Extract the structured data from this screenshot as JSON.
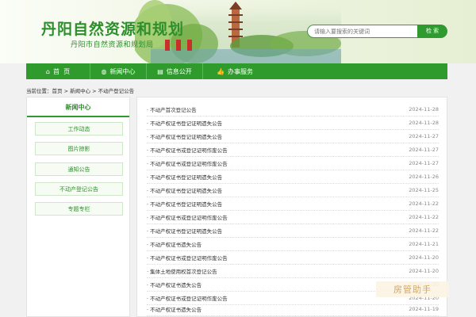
{
  "header": {
    "site_title": "丹阳自然资源和规划",
    "site_subtitle": "丹阳市自然资源和规划局",
    "search_placeholder": "请输入要搜索的关键词",
    "search_button": "检 索"
  },
  "nav": {
    "items": [
      {
        "label": "首  页",
        "icon": "home-icon"
      },
      {
        "label": "新闻中心",
        "icon": "globe-icon"
      },
      {
        "label": "信息公开",
        "icon": "document-icon"
      },
      {
        "label": "办事服务",
        "icon": "thumbs-up-icon"
      }
    ]
  },
  "breadcrumb": {
    "text": "当前位置：首页 > 新闻中心 > 不动产登记公告"
  },
  "sidebar": {
    "title": "新闻中心",
    "items": [
      "工作动态",
      "图片掠影",
      "通知公告",
      "不动产登记公告",
      "专题专栏"
    ]
  },
  "news": {
    "items": [
      {
        "title": "· 不动产首次登记公告",
        "date": "2024-11-28"
      },
      {
        "title": "· 不动产权证书登记证明遗失公告",
        "date": "2024-11-28"
      },
      {
        "title": "· 不动产权证书登记证明遗失公告",
        "date": "2024-11-27"
      },
      {
        "title": "· 不动产权证书或登记证明作废公告",
        "date": "2024-11-27"
      },
      {
        "title": "· 不动产权证书或登记证明作废公告",
        "date": "2024-11-27"
      },
      {
        "title": "· 不动产权证书登记证明遗失公告",
        "date": "2024-11-26"
      },
      {
        "title": "· 不动产权证书登记证明遗失公告",
        "date": "2024-11-25"
      },
      {
        "title": "· 不动产权证书登记证明遗失公告",
        "date": "2024-11-22"
      },
      {
        "title": "· 不动产权证书或登记证明作废公告",
        "date": "2024-11-22"
      },
      {
        "title": "· 不动产权证书登记证明遗失公告",
        "date": "2024-11-22"
      },
      {
        "title": "· 不动产权证书遗失公告",
        "date": "2024-11-21"
      },
      {
        "title": "· 不动产权证书或登记证明作废公告",
        "date": "2024-11-20"
      },
      {
        "title": "· 集体土地使用权首次登记公告",
        "date": "2024-11-20"
      },
      {
        "title": "· 不动产权证书遗失公告",
        "date": "2024-11-20"
      },
      {
        "title": "· 不动产权证书或登记证明作废公告",
        "date": "2024-11-20"
      },
      {
        "title": "· 不动产权证书遗失公告",
        "date": "2024-11-19"
      }
    ]
  },
  "watermark": {
    "text": "房管助手"
  },
  "colors": {
    "brand_green": "#2f9b2d",
    "title_green": "#2d8f2b"
  }
}
